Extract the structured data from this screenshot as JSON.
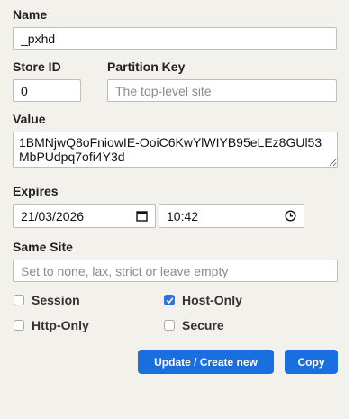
{
  "name": {
    "label": "Name",
    "value": "_pxhd"
  },
  "store_id": {
    "label": "Store ID",
    "value": "0"
  },
  "partition_key": {
    "label": "Partition Key",
    "placeholder": "The top-level site",
    "value": ""
  },
  "value_field": {
    "label": "Value",
    "value": "1BMNjwQ8oFniowIE-OoiC6KwYlWIYB95eLEz8GUl53MbPUdpq7ofi4Y3d"
  },
  "expires": {
    "label": "Expires",
    "date": "21/03/2026",
    "time": "10:42",
    "date_icon": "calendar-icon",
    "time_icon": "clock-icon"
  },
  "same_site": {
    "label": "Same Site",
    "placeholder": "Set to none, lax, strict or leave empty",
    "value": ""
  },
  "flags": [
    {
      "label": "Session",
      "checked": false
    },
    {
      "label": "Host-Only",
      "checked": true
    },
    {
      "label": "Http-Only",
      "checked": false
    },
    {
      "label": "Secure",
      "checked": false
    }
  ],
  "buttons": {
    "update_label": "Update / Create new",
    "copy_label": "Copy"
  },
  "colors": {
    "accent": "#1a6fe0",
    "panel_bg": "#f3f1ec"
  }
}
